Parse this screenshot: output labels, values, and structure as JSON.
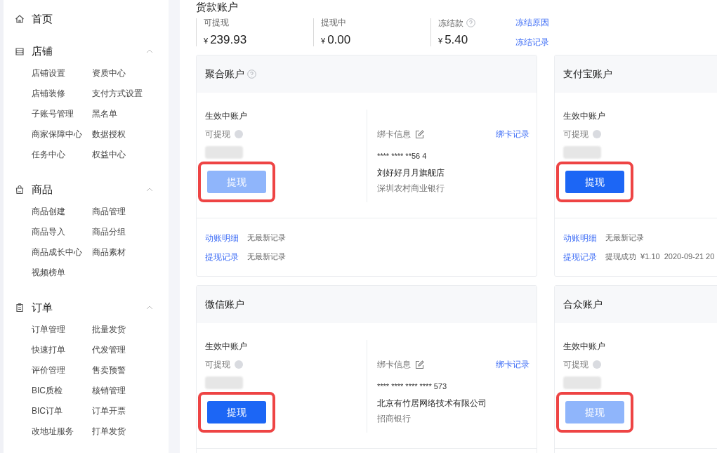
{
  "sidebar": {
    "home": {
      "label": "首页"
    },
    "sections": [
      {
        "label": "店铺",
        "expanded": true,
        "items": [
          "店铺设置",
          "资质中心",
          "店铺装修",
          "支付方式设置",
          "子账号管理",
          "黑名单",
          "商家保障中心",
          "数据授权",
          "任务中心",
          "权益中心"
        ]
      },
      {
        "label": "商品",
        "expanded": true,
        "items": [
          "商品创建",
          "商品管理",
          "商品导入",
          "商品分组",
          "商品成长中心",
          "商品素材",
          "视频榜单"
        ]
      },
      {
        "label": "订单",
        "expanded": true,
        "items": [
          "订单管理",
          "批量发货",
          "快速打单",
          "代发管理",
          "评价管理",
          "售卖预警",
          "BIC质检",
          "核销管理",
          "BIC订单",
          "订单开票",
          "改地址服务",
          "打单发货"
        ]
      }
    ]
  },
  "page_title": "货款账户",
  "stats": [
    {
      "label": "可提现",
      "help": false,
      "currency": "¥",
      "amount": "239.93"
    },
    {
      "label": "提现中",
      "help": false,
      "currency": "¥",
      "amount": "0.00"
    },
    {
      "label": "冻结款",
      "help": true,
      "currency": "¥",
      "amount": "5.40"
    }
  ],
  "stat_links": [
    "冻结原因",
    "冻结记录"
  ],
  "accounts": [
    {
      "title": "聚合账户",
      "help": true,
      "status_label": "生效中账户",
      "available_label": "可提现",
      "button": {
        "label": "提现",
        "disabled": true,
        "highlighted": true
      },
      "bank": {
        "label": "绑卡信息",
        "record_link": "绑卡记录",
        "card_number": "**** **** **56 4",
        "holder": "刘好好月月旗舰店",
        "bank_name": "深圳农村商业银行"
      },
      "records": [
        {
          "link": "动账明细",
          "text": "无最新记录"
        },
        {
          "link": "提现记录",
          "text": "无最新记录"
        }
      ]
    },
    {
      "title": "支付宝账户",
      "help": false,
      "status_label": "生效中账户",
      "available_label": "可提现",
      "button": {
        "label": "提现",
        "disabled": false,
        "highlighted": true
      },
      "records": [
        {
          "link": "动账明细",
          "text": "无最新记录"
        },
        {
          "link": "提现记录",
          "text": "提现成功  ¥1.10  2020-09-21 20"
        }
      ]
    },
    {
      "title": "微信账户",
      "help": false,
      "status_label": "生效中账户",
      "available_label": "可提现",
      "button": {
        "label": "提现",
        "disabled": false,
        "highlighted": true
      },
      "bank": {
        "label": "绑卡信息",
        "record_link": "绑卡记录",
        "card_number": "**** **** **** **** 573",
        "holder": "北京有竹居网络技术有限公司",
        "bank_name": "招商银行"
      }
    },
    {
      "title": "合众账户",
      "help": false,
      "status_label": "生效中账户",
      "available_label": "可提现",
      "button": {
        "label": "提现",
        "disabled": true,
        "highlighted": true
      }
    }
  ]
}
